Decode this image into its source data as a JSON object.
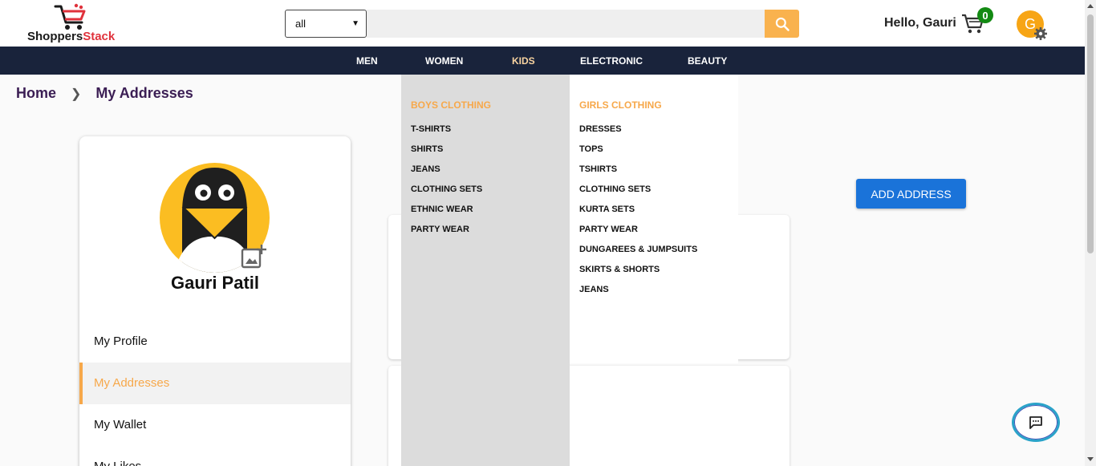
{
  "brand": {
    "name_part1": "Shoppers",
    "name_part2": "Stack",
    "accent_color": "#e0323c"
  },
  "search": {
    "category_value": "all",
    "placeholder": "",
    "icon": "search-icon"
  },
  "user": {
    "greeting": "Hello, Gauri",
    "cart_count": "0",
    "avatar_letter": "G"
  },
  "nav": {
    "items": [
      "MEN",
      "WOMEN",
      "KIDS",
      "ELECTRONIC",
      "BEAUTY"
    ],
    "active": "KIDS"
  },
  "breadcrumb": {
    "home": "Home",
    "current": "My Addresses"
  },
  "profile": {
    "name": "Gauri Patil",
    "menu": [
      "My Profile",
      "My Addresses",
      "My Wallet",
      "My Likes"
    ],
    "active_menu": "My Addresses"
  },
  "actions": {
    "add_address": "ADD ADDRESS"
  },
  "mega_menu": {
    "boys": {
      "heading": "BOYS CLOTHING",
      "links": [
        "T-SHIRTS",
        "SHIRTS",
        "JEANS",
        "CLOTHING SETS",
        "ETHNIC WEAR",
        "PARTY WEAR"
      ]
    },
    "girls": {
      "heading": "GIRLS CLOTHING",
      "links": [
        "DRESSES",
        "TOPS",
        "TSHIRTS",
        "CLOTHING SETS",
        "KURTA SETS",
        "PARTY WEAR",
        "DUNGAREES & JUMPSUITS",
        "SKIRTS & SHORTS",
        "JEANS"
      ]
    }
  },
  "colors": {
    "accent_orange": "#f7a84a",
    "nav_bg": "#19233b",
    "primary_blue": "#1a73d9"
  }
}
